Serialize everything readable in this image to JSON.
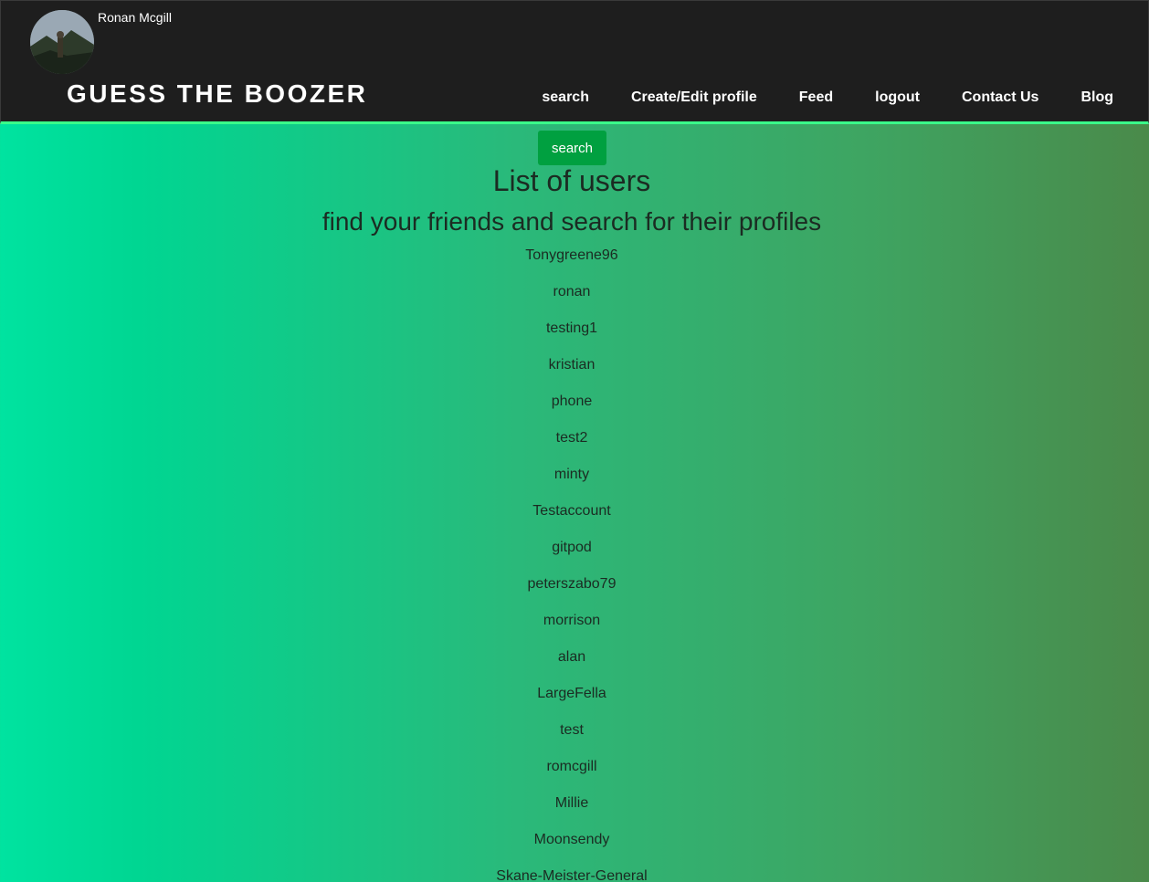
{
  "header": {
    "username": "Ronan Mcgill",
    "brand": "GUESS THE BOOZER",
    "nav": [
      {
        "label": "search"
      },
      {
        "label": "Create/Edit profile"
      },
      {
        "label": "Feed"
      },
      {
        "label": "logout"
      },
      {
        "label": "Contact Us"
      },
      {
        "label": "Blog"
      }
    ]
  },
  "main": {
    "search_button": "search",
    "title": "List of users",
    "subtitle": "find your friends and search for their profiles",
    "users": [
      "Tonygreene96",
      "ronan",
      "testing1",
      "kristian",
      "phone",
      "test2",
      "minty",
      "Testaccount",
      "gitpod",
      "peterszabo79",
      "morrison",
      "alan",
      "LargeFella",
      "test",
      "romcgill",
      "Millie",
      "Moonsendy",
      "Skane-Meister-General"
    ]
  },
  "colors": {
    "navbar_bg": "#1e1e1e",
    "navbar_accent": "#3aff8a",
    "button_bg": "#00a040",
    "gradient_start": "#00e3a0",
    "gradient_end": "#4a8a4a"
  }
}
